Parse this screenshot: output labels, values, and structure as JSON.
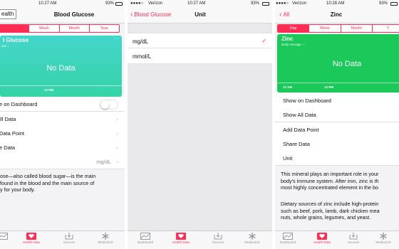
{
  "colors": {
    "accent": "#ff2d55",
    "card": "#3fd7b3",
    "card_top": "#4ad7c8",
    "zinc_card": "#1ac95a"
  },
  "left": {
    "status": {
      "time": "10:27 AM",
      "battery": "93%"
    },
    "back_label": "ealth",
    "title": "Blood Glucose",
    "segments": [
      {
        "label": "",
        "active": true
      },
      {
        "label": "Week",
        "active": false
      },
      {
        "label": "Month",
        "active": false
      },
      {
        "label": "Year",
        "active": false
      }
    ],
    "card": {
      "title": "l Glucose",
      "subtitle": "ues ↓",
      "no_data": "No Data",
      "tick": "12 PM"
    },
    "rows": {
      "show_dashboard": "e on Dashboard",
      "show_all": "Ill Data",
      "add_point": "Data Point",
      "share": "e Data",
      "unit_value": "mg/dL"
    },
    "description": [
      "ose—also called blood sugar—is the main",
      "found in the blood and the main source of",
      "y for your body."
    ],
    "tabs": [
      "",
      "Health Data",
      "Sources",
      "Medical ID"
    ]
  },
  "middle": {
    "status": {
      "carrier": "Verizon",
      "time": "10:27 AM",
      "battery": "93%"
    },
    "back_label": "Blood Glucose",
    "title": "Unit",
    "options": [
      {
        "label": "mg/dL",
        "selected": true
      },
      {
        "label": "mmol/L",
        "selected": false
      }
    ],
    "tabs": [
      "Dashboard",
      "Health Data",
      "Sources",
      "Medical ID"
    ]
  },
  "right": {
    "status": {
      "carrier": "Verizon",
      "time": "10:28 AM",
      "battery": "93%"
    },
    "back_label": "All",
    "title": "Zinc",
    "segments": [
      {
        "label": "Day",
        "active": true
      },
      {
        "label": "Week",
        "active": false
      },
      {
        "label": "Month",
        "active": false
      },
      {
        "label": "Y",
        "active": false
      }
    ],
    "card": {
      "title": "Zinc",
      "subtitle": "Daily Average: –",
      "no_data": "No Data",
      "tick": "12 PM"
    },
    "rows": {
      "show_dashboard": "Show on Dashboard",
      "show_all": "Show All Data",
      "add_point": "Add Data Point",
      "share": "Share Data",
      "unit": "Unit"
    },
    "description1": [
      "This mineral plays an important role in your",
      "body's immune system. After iron, zinc is th",
      "most highly concentrated element in the bo"
    ],
    "description2": [
      "Dietary sources of zinc include high-protein",
      "such as beef, pork, lamb, dark chicken mea",
      "nuts, whole grains, legumes, and yeast."
    ],
    "tabs": [
      "Dashboard",
      "Health Data",
      "Sources",
      "Medical ID"
    ]
  }
}
